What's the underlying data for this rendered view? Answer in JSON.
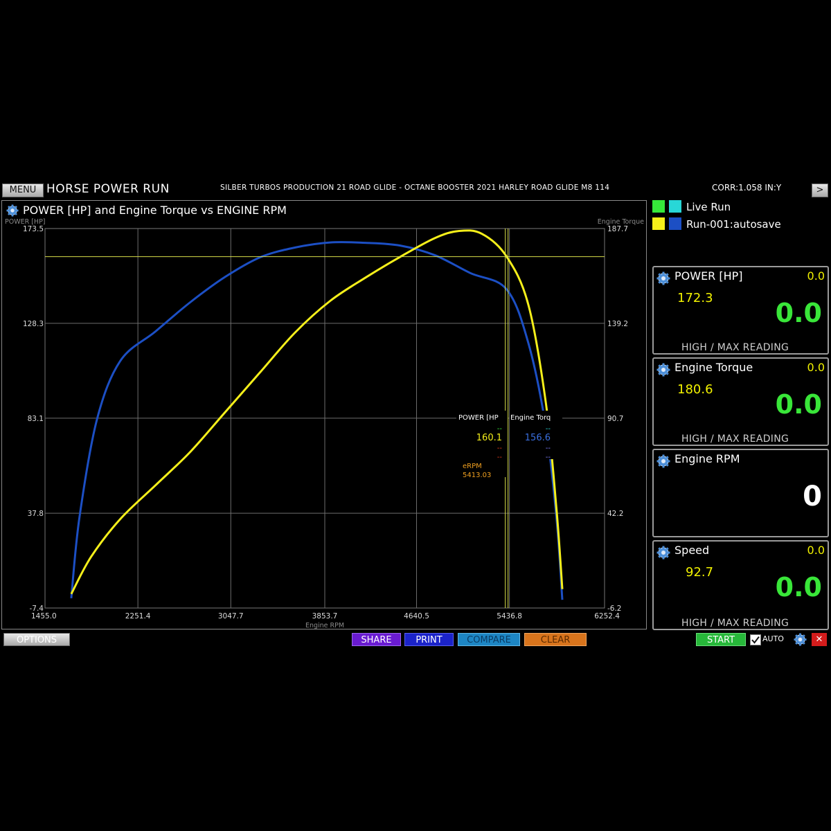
{
  "topbar": {
    "menu_label": "MENU",
    "app_title": "HORSE POWER RUN",
    "run_description": "SILBER TURBOS PRODUCTION 21 ROAD GLIDE - OCTANE BOOSTER 2021 HARLEY ROAD GLIDE M8 114",
    "correction": "CORR:1.058 IN:Y",
    "next_label": ">"
  },
  "chart_panel": {
    "title": "POWER [HP] and Engine Torque vs ENGINE RPM",
    "icon": "gear-icon"
  },
  "legend": {
    "items": [
      {
        "label": "Live Run",
        "colors": [
          "#36e83a",
          "#28d7d7"
        ]
      },
      {
        "label": "Run-001:autosave",
        "colors": [
          "#f5ef1a",
          "#1c4fc4"
        ]
      }
    ]
  },
  "cursor_readout": {
    "col1_header": "POWER [HP",
    "col2_header": "Engine Torq",
    "row1_col1": "--",
    "row1_col2": "--",
    "row2_col1": "160.1",
    "row2_col2": "156.6",
    "row3_col1": "--",
    "row3_col2": "--",
    "row4_col1": "--",
    "row4_col2": "--",
    "erpm_label": "eRPM",
    "erpm_value": "5413.03"
  },
  "gauges": {
    "power": {
      "title": "POWER [HP]",
      "small": "0.0",
      "max": "172.3",
      "big": "0.0",
      "footer": "HIGH / MAX READING"
    },
    "torque": {
      "title": "Engine Torque",
      "small": "0.0",
      "max": "180.6",
      "big": "0.0",
      "footer": "HIGH / MAX READING"
    },
    "rpm": {
      "title": "Engine RPM",
      "big": "0"
    },
    "speed": {
      "title": "Speed",
      "small": "0.0",
      "max": "92.7",
      "big": "0.0",
      "footer": "HIGH / MAX READING"
    }
  },
  "bottombar": {
    "options_label": "OPTIONS",
    "share_label": "SHARE",
    "print_label": "PRINT",
    "compare_label": "COMPARE",
    "clear_label": "CLEAR",
    "start_label": "START",
    "auto_label": "AUTO",
    "auto_checked": true,
    "close_label": "✕"
  },
  "chart_data": {
    "type": "line",
    "title": "POWER [HP] and Engine Torque vs ENGINE RPM",
    "xlabel": "Engine RPM",
    "ylabel_left": "POWER [HP]",
    "ylabel_right": "Engine Torque",
    "xlim": [
      1455.0,
      6252.4
    ],
    "ylim_left": [
      -7.4,
      173.5
    ],
    "ylim_right": [
      -6.2,
      187.7
    ],
    "x_ticks": [
      "1455.0",
      "2251.4",
      "3047.7",
      "3853.7",
      "4640.5",
      "5436.8",
      "6252.4"
    ],
    "y_left_ticks": [
      "173.5",
      "128.3",
      "83.1",
      "37.8",
      "-7.4"
    ],
    "y_right_ticks": [
      "187.7",
      "139.2",
      "90.7",
      "42.2",
      "-6.2"
    ],
    "grid": true,
    "cursor": {
      "rpm": 5413.03,
      "power_hp": 160.1,
      "torque": 156.6
    },
    "series": [
      {
        "name": "POWER [HP]",
        "axis": "left",
        "color": "#f5ef1a",
        "points": [
          [
            1680,
            -0.7
          ],
          [
            1850,
            17
          ],
          [
            2100,
            35
          ],
          [
            2400,
            51
          ],
          [
            2700,
            67
          ],
          [
            3000,
            86
          ],
          [
            3300,
            105
          ],
          [
            3600,
            124
          ],
          [
            3900,
            139
          ],
          [
            4200,
            150
          ],
          [
            4500,
            160
          ],
          [
            4800,
            169
          ],
          [
            5000,
            172.3
          ],
          [
            5200,
            171
          ],
          [
            5413.03,
            160.1
          ],
          [
            5600,
            137
          ],
          [
            5750,
            90
          ],
          [
            5840,
            40
          ],
          [
            5890,
            1.6
          ]
        ]
      },
      {
        "name": "Engine Torque",
        "axis": "right",
        "color": "#1c4fc4",
        "points": [
          [
            1680,
            -1.2
          ],
          [
            1750,
            40
          ],
          [
            1900,
            90
          ],
          [
            2100,
            120
          ],
          [
            2400,
            135
          ],
          [
            2700,
            150
          ],
          [
            3000,
            163
          ],
          [
            3300,
            173
          ],
          [
            3600,
            178
          ],
          [
            3900,
            180.6
          ],
          [
            4200,
            180.4
          ],
          [
            4500,
            179
          ],
          [
            4800,
            174
          ],
          [
            5100,
            165
          ],
          [
            5413.03,
            156.6
          ],
          [
            5600,
            129
          ],
          [
            5750,
            86
          ],
          [
            5840,
            40
          ],
          [
            5890,
            -2
          ]
        ]
      }
    ]
  }
}
